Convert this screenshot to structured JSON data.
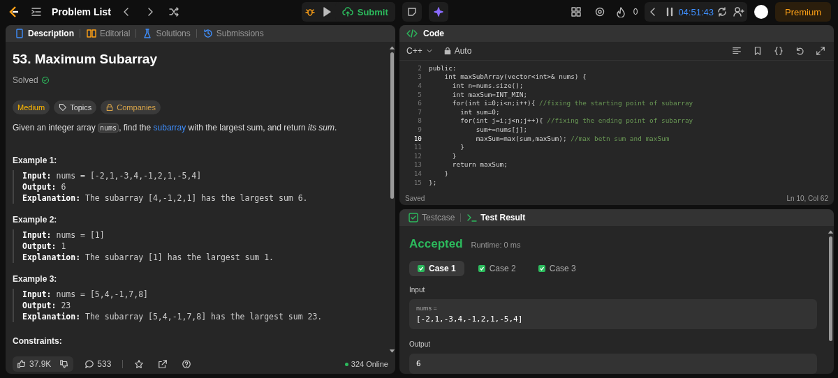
{
  "topbar": {
    "title": "Problem List",
    "submit": "Submit",
    "streak": "0",
    "timer": "04:51:43",
    "premium": "Premium"
  },
  "description": {
    "tabs": [
      {
        "label": "Description",
        "selected": true
      },
      {
        "label": "Editorial",
        "selected": false
      },
      {
        "label": "Solutions",
        "selected": false
      },
      {
        "label": "Submissions",
        "selected": false
      }
    ],
    "title": "53. Maximum Subarray",
    "status": "Solved",
    "tags": [
      {
        "label": "Medium",
        "kind": "difficulty"
      },
      {
        "label": "Topics",
        "kind": "topics"
      },
      {
        "label": "Companies",
        "kind": "companies"
      }
    ],
    "statement": [
      {
        "kind": "text",
        "text": "Given an integer array "
      },
      {
        "kind": "code",
        "text": "nums"
      },
      {
        "kind": "text",
        "text": ", find the "
      },
      {
        "kind": "link",
        "text": "subarray"
      },
      {
        "kind": "text",
        "text": " with the largest sum, and return *its sum*."
      }
    ],
    "examples": [
      {
        "heading": "Example 1:",
        "lines": [
          "**Input:** nums = [-2,1,-3,4,-1,2,1,-5,4]",
          "**Output:** 6",
          "**Explanation:** The subarray [4,-1,2,1] has the largest sum 6."
        ]
      },
      {
        "heading": "Example 2:",
        "lines": [
          "**Input:** nums = [1]",
          "**Output:** 1",
          "**Explanation:** The subarray [1] has the largest sum 1."
        ]
      },
      {
        "heading": "Example 3:",
        "lines": [
          "**Input:** nums = [5,4,-1,7,8]",
          "**Output:** 23",
          "**Explanation:** The subarray [5,4,-1,7,8] has the largest sum 23."
        ]
      }
    ],
    "constraints_heading": "Constraints:",
    "footer": {
      "likes": "37.9K",
      "comments": "533",
      "online": "324 Online"
    }
  },
  "code": {
    "title": "Code",
    "language": "C++",
    "mode": "Auto",
    "lines": [
      {
        "num": "2",
        "code": "public:",
        "current": false
      },
      {
        "num": "3",
        "code": "    int maxSubArray(vector<int>& nums) {",
        "current": false
      },
      {
        "num": "4",
        "code": "      int n=nums.size();",
        "current": false
      },
      {
        "num": "5",
        "code": "      int maxSum=INT_MIN;",
        "current": false
      },
      {
        "num": "6",
        "code": "      for(int i=0;i<n;i++){ ",
        "comment": "//fixing the starting point of subarray",
        "current": false
      },
      {
        "num": "7",
        "code": "        int sum=0;",
        "current": false
      },
      {
        "num": "8",
        "code": "        for(int j=i;j<n;j++){ ",
        "comment": "//fixing the ending point of subarray",
        "current": false
      },
      {
        "num": "9",
        "code": "            sum+=nums[j];",
        "current": false
      },
      {
        "num": "10",
        "code": "            maxSum=max(sum,maxSum); ",
        "comment": "//max betn sum and maxSum",
        "current": true
      },
      {
        "num": "11",
        "code": "        }",
        "current": false
      },
      {
        "num": "12",
        "code": "      }",
        "current": false
      },
      {
        "num": "13",
        "code": "      return maxSum;",
        "current": false
      },
      {
        "num": "14",
        "code": "    }",
        "current": false
      },
      {
        "num": "15",
        "code": "};",
        "current": false
      }
    ],
    "saved": "Saved",
    "cursor": "Ln 10, Col 62"
  },
  "tests": {
    "tabs": [
      {
        "label": "Testcase",
        "selected": false
      },
      {
        "label": "Test Result",
        "selected": true
      }
    ],
    "verdict": "Accepted",
    "runtime": "Runtime: 0 ms",
    "cases": [
      {
        "label": "Case 1",
        "selected": true,
        "passed": true
      },
      {
        "label": "Case 2",
        "selected": false,
        "passed": true
      },
      {
        "label": "Case 3",
        "selected": false,
        "passed": true
      }
    ],
    "input_label": "Input",
    "param_name": "nums =",
    "param_value": "[-2,1,-3,4,-1,2,1,-5,4]",
    "output_label": "Output",
    "output_value": "6"
  }
}
